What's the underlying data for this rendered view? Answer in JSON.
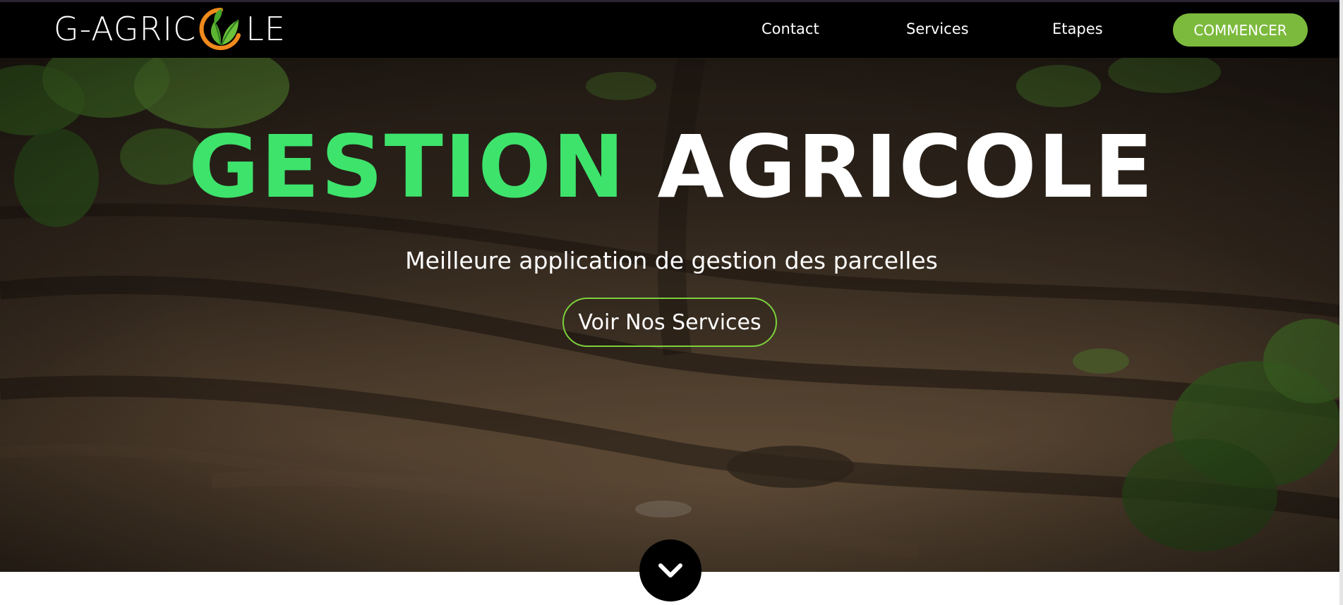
{
  "header": {
    "logo": {
      "text_before": "G-AGRIC",
      "text_after": "LE",
      "mark_icon": "leaf-circle-icon",
      "colors": {
        "ring": "#f08a1c",
        "leaves": "#5cb531",
        "leaf_dark": "#2f7a22"
      }
    },
    "nav": [
      {
        "label": "Contact"
      },
      {
        "label": "Services"
      },
      {
        "label": "Etapes"
      }
    ],
    "cta_label": "COMMENCER"
  },
  "hero": {
    "title_part1": "GESTION",
    "title_part2": "AGRICOLE",
    "subtitle": "Meilleure application de gestion des parcelles",
    "button_label": "Voir Nos Services",
    "scroll_icon": "chevron-down-icon"
  },
  "colors": {
    "accent_green": "#7cba3d",
    "title_green": "#3ee36c",
    "header_bg": "#000000"
  }
}
